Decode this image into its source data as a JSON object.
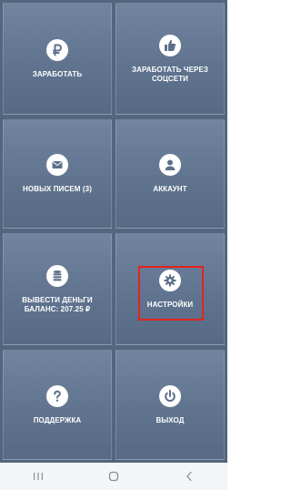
{
  "menu": {
    "tiles": [
      {
        "label": "ЗАРАБОТАТЬ",
        "icon": "ruble-icon"
      },
      {
        "label": "ЗАРАБОТАТЬ ЧЕРЕЗ\nСОЦСЕТИ",
        "icon": "thumbs-up-icon"
      },
      {
        "label": "НОВЫХ ПИСЕМ (3)",
        "icon": "envelope-icon"
      },
      {
        "label": "АККАУНТ",
        "icon": "user-icon"
      },
      {
        "label": "ВЫВЕСТИ ДЕНЬГИ\nБАЛАНС: 207.25 ₽",
        "icon": "coins-icon"
      },
      {
        "label": "НАСТРОЙКИ",
        "icon": "gear-icon"
      },
      {
        "label": "ПОДДЕРЖКА",
        "icon": "question-icon"
      },
      {
        "label": "ВЫХОД",
        "icon": "power-icon"
      }
    ]
  },
  "navbar": {
    "icons": [
      "recent-apps-icon",
      "home-icon",
      "back-icon"
    ]
  },
  "colors": {
    "tile": "#60748f",
    "background": "#52667e",
    "highlight": "#e3231e",
    "icon_glyph": "#5d708b"
  }
}
